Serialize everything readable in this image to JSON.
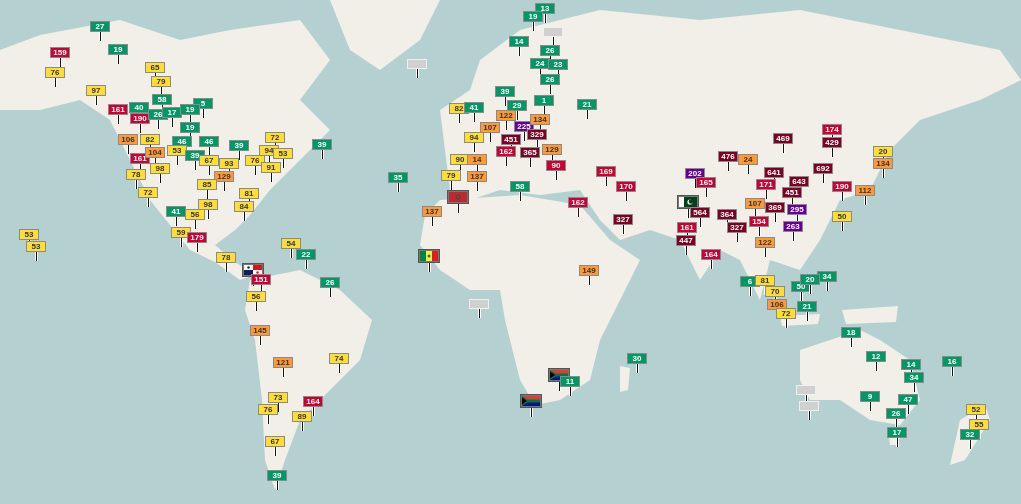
{
  "map": {
    "markers": [
      {
        "kind": "aqi",
        "value": "13",
        "color": "#009966"
      },
      {
        "kind": "aqi",
        "value": "19",
        "color": "#009966"
      },
      {
        "kind": "aqi",
        "value": "27",
        "color": "#009966"
      },
      {
        "kind": "blank"
      },
      {
        "kind": "aqi",
        "value": "14",
        "color": "#009966"
      },
      {
        "kind": "aqi",
        "value": "159",
        "color": "#cc0033"
      },
      {
        "kind": "aqi",
        "value": "19",
        "color": "#009966"
      },
      {
        "kind": "aqi",
        "value": "26",
        "color": "#009966"
      },
      {
        "kind": "aqi",
        "value": "65",
        "color": "#ffde33"
      },
      {
        "kind": "blank"
      },
      {
        "kind": "aqi",
        "value": "24",
        "color": "#009966"
      },
      {
        "kind": "aqi",
        "value": "23",
        "color": "#009966"
      },
      {
        "kind": "aqi",
        "value": "76",
        "color": "#ffde33"
      },
      {
        "kind": "aqi",
        "value": "79",
        "color": "#ffde33"
      },
      {
        "kind": "aqi",
        "value": "26",
        "color": "#009966"
      },
      {
        "kind": "aqi",
        "value": "97",
        "color": "#ffde33"
      },
      {
        "kind": "aqi",
        "value": "39",
        "color": "#009966"
      },
      {
        "kind": "aqi",
        "value": "40",
        "color": "#009966"
      },
      {
        "kind": "aqi",
        "value": "58",
        "color": "#009966"
      },
      {
        "kind": "aqi",
        "value": "5",
        "color": "#009966"
      },
      {
        "kind": "aqi",
        "value": "82",
        "color": "#ffde33"
      },
      {
        "kind": "aqi",
        "value": "41",
        "color": "#009966"
      },
      {
        "kind": "aqi",
        "value": "29",
        "color": "#009966"
      },
      {
        "kind": "aqi",
        "value": "1",
        "color": "#009966"
      },
      {
        "kind": "aqi",
        "value": "21",
        "color": "#009966"
      },
      {
        "kind": "aqi",
        "value": "161",
        "color": "#cc0033"
      },
      {
        "kind": "aqi",
        "value": "190",
        "color": "#cc0033"
      },
      {
        "kind": "aqi",
        "value": "26",
        "color": "#009966"
      },
      {
        "kind": "aqi",
        "value": "17",
        "color": "#009966"
      },
      {
        "kind": "aqi",
        "value": "19",
        "color": "#009966"
      },
      {
        "kind": "aqi",
        "value": "122",
        "color": "#ff9933"
      },
      {
        "kind": "aqi",
        "value": "19",
        "color": "#009966"
      },
      {
        "kind": "aqi",
        "value": "107",
        "color": "#ff9933"
      },
      {
        "kind": "aqi",
        "value": "225",
        "color": "#660099"
      },
      {
        "kind": "aqi",
        "value": "134",
        "color": "#ff9933"
      },
      {
        "kind": "aqi",
        "value": "72",
        "color": "#ffde33"
      },
      {
        "kind": "aqi",
        "value": "94",
        "color": "#ffde33"
      },
      {
        "kind": "aqi",
        "value": "329",
        "color": "#7e0023"
      },
      {
        "kind": "aqi",
        "value": "469",
        "color": "#7e0023"
      },
      {
        "kind": "aqi",
        "value": "174",
        "color": "#cc0033"
      },
      {
        "kind": "aqi",
        "value": "106",
        "color": "#ff9933"
      },
      {
        "kind": "aqi",
        "value": "82",
        "color": "#ffde33"
      },
      {
        "kind": "aqi",
        "value": "46",
        "color": "#009966"
      },
      {
        "kind": "aqi",
        "value": "46",
        "color": "#009966"
      },
      {
        "kind": "aqi",
        "value": "39",
        "color": "#009966"
      },
      {
        "kind": "aqi",
        "value": "39",
        "color": "#009966"
      },
      {
        "kind": "aqi",
        "value": "451",
        "color": "#7e0023"
      },
      {
        "kind": "aqi",
        "value": "429",
        "color": "#7e0023"
      },
      {
        "kind": "aqi",
        "value": "161",
        "color": "#cc0033"
      },
      {
        "kind": "aqi",
        "value": "104",
        "color": "#ff9933"
      },
      {
        "kind": "aqi",
        "value": "53",
        "color": "#ffde33"
      },
      {
        "kind": "aqi",
        "value": "39",
        "color": "#009966"
      },
      {
        "kind": "aqi",
        "value": "94",
        "color": "#ffde33"
      },
      {
        "kind": "aqi",
        "value": "53",
        "color": "#ffde33"
      },
      {
        "kind": "aqi",
        "value": "162",
        "color": "#cc0033"
      },
      {
        "kind": "aqi",
        "value": "365",
        "color": "#7e0023"
      },
      {
        "kind": "aqi",
        "value": "129",
        "color": "#ff9933"
      },
      {
        "kind": "aqi",
        "value": "476",
        "color": "#7e0023"
      },
      {
        "kind": "aqi",
        "value": "20",
        "color": "#ffde33"
      },
      {
        "kind": "aqi",
        "value": "98",
        "color": "#ffde33"
      },
      {
        "kind": "aqi",
        "value": "67",
        "color": "#ffde33"
      },
      {
        "kind": "aqi",
        "value": "93",
        "color": "#ffde33"
      },
      {
        "kind": "aqi",
        "value": "76",
        "color": "#ffde33"
      },
      {
        "kind": "aqi",
        "value": "91",
        "color": "#ffde33"
      },
      {
        "kind": "aqi",
        "value": "90",
        "color": "#ffde33"
      },
      {
        "kind": "aqi",
        "value": "14",
        "color": "#ff9933"
      },
      {
        "kind": "aqi",
        "value": "90",
        "color": "#cc0033"
      },
      {
        "kind": "aqi",
        "value": "24",
        "color": "#ff9933"
      },
      {
        "kind": "aqi",
        "value": "692",
        "color": "#7e0023"
      },
      {
        "kind": "aqi",
        "value": "134",
        "color": "#ff9933"
      },
      {
        "kind": "aqi",
        "value": "78",
        "color": "#ffde33"
      },
      {
        "kind": "aqi",
        "value": "129",
        "color": "#ff9933"
      },
      {
        "kind": "aqi",
        "value": "35",
        "color": "#009966"
      },
      {
        "kind": "aqi",
        "value": "79",
        "color": "#ffde33"
      },
      {
        "kind": "aqi",
        "value": "137",
        "color": "#ff9933"
      },
      {
        "kind": "aqi",
        "value": "169",
        "color": "#cc0033"
      },
      {
        "kind": "aqi",
        "value": "202",
        "color": "#660099"
      },
      {
        "kind": "aqi",
        "value": "641",
        "color": "#7e0023"
      },
      {
        "kind": "aqi",
        "value": "85",
        "color": "#ffde33"
      },
      {
        "kind": "aqi",
        "value": "58",
        "color": "#009966"
      },
      {
        "kind": "aqi",
        "value": "170",
        "color": "#cc0033"
      },
      {
        "kind": "aqi",
        "value": "165",
        "color": "#cc0033"
      },
      {
        "kind": "aqi",
        "value": "171",
        "color": "#cc0033"
      },
      {
        "kind": "aqi",
        "value": "643",
        "color": "#7e0023"
      },
      {
        "kind": "aqi",
        "value": "190",
        "color": "#cc0033"
      },
      {
        "kind": "aqi",
        "value": "72",
        "color": "#ffde33"
      },
      {
        "kind": "aqi",
        "value": "81",
        "color": "#ffde33"
      },
      {
        "kind": "flag"
      },
      {
        "kind": "aqi",
        "value": "451",
        "color": "#7e0023"
      },
      {
        "kind": "aqi",
        "value": "112",
        "color": "#ff9933"
      },
      {
        "kind": "aqi",
        "value": "98",
        "color": "#ffde33"
      },
      {
        "kind": "aqi",
        "value": "84",
        "color": "#ffde33"
      },
      {
        "kind": "aqi",
        "value": "162",
        "color": "#cc0033"
      },
      {
        "kind": "flag"
      },
      {
        "kind": "aqi",
        "value": "107",
        "color": "#ff9933"
      },
      {
        "kind": "aqi",
        "value": "369",
        "color": "#7e0023"
      },
      {
        "kind": "aqi",
        "value": "41",
        "color": "#009966"
      },
      {
        "kind": "aqi",
        "value": "56",
        "color": "#ffde33"
      },
      {
        "kind": "aqi",
        "value": "137",
        "color": "#ff9933"
      },
      {
        "kind": "aqi",
        "value": "564",
        "color": "#7e0023"
      },
      {
        "kind": "aqi",
        "value": "364",
        "color": "#7e0023"
      },
      {
        "kind": "aqi",
        "value": "295",
        "color": "#660099"
      },
      {
        "kind": "aqi",
        "value": "50",
        "color": "#ffde33"
      },
      {
        "kind": "aqi",
        "value": "327",
        "color": "#7e0023"
      },
      {
        "kind": "aqi",
        "value": "161",
        "color": "#cc0033"
      },
      {
        "kind": "aqi",
        "value": "327",
        "color": "#7e0023"
      },
      {
        "kind": "aqi",
        "value": "154",
        "color": "#cc0033"
      },
      {
        "kind": "aqi",
        "value": "263",
        "color": "#660099"
      },
      {
        "kind": "aqi",
        "value": "53",
        "color": "#ffde33"
      },
      {
        "kind": "aqi",
        "value": "59",
        "color": "#ffde33"
      },
      {
        "kind": "aqi",
        "value": "179",
        "color": "#cc0033"
      },
      {
        "kind": "aqi",
        "value": "53",
        "color": "#ffde33"
      },
      {
        "kind": "aqi",
        "value": "54",
        "color": "#ffde33"
      },
      {
        "kind": "aqi",
        "value": "447",
        "color": "#7e0023"
      },
      {
        "kind": "aqi",
        "value": "122",
        "color": "#ff9933"
      },
      {
        "kind": "aqi",
        "value": "78",
        "color": "#ffde33"
      },
      {
        "kind": "aqi",
        "value": "22",
        "color": "#009966"
      },
      {
        "kind": "flag"
      },
      {
        "kind": "aqi",
        "value": "164",
        "color": "#cc0033"
      },
      {
        "kind": "flag"
      },
      {
        "kind": "aqi",
        "value": "149",
        "color": "#ff9933"
      },
      {
        "kind": "aqi",
        "value": "34",
        "color": "#009966"
      },
      {
        "kind": "aqi",
        "value": "151",
        "color": "#cc0033"
      },
      {
        "kind": "aqi",
        "value": "26",
        "color": "#009966"
      },
      {
        "kind": "aqi",
        "value": "6",
        "color": "#009966"
      },
      {
        "kind": "aqi",
        "value": "81",
        "color": "#ffde33"
      },
      {
        "kind": "aqi",
        "value": "50",
        "color": "#009966"
      },
      {
        "kind": "aqi",
        "value": "20",
        "color": "#009966"
      },
      {
        "kind": "aqi",
        "value": "56",
        "color": "#ffde33"
      },
      {
        "kind": "aqi",
        "value": "70",
        "color": "#ffde33"
      },
      {
        "kind": "blank"
      },
      {
        "kind": "aqi",
        "value": "106",
        "color": "#ff9933"
      },
      {
        "kind": "aqi",
        "value": "21",
        "color": "#009966"
      },
      {
        "kind": "aqi",
        "value": "72",
        "color": "#ffde33"
      },
      {
        "kind": "aqi",
        "value": "145",
        "color": "#ff9933"
      },
      {
        "kind": "aqi",
        "value": "18",
        "color": "#009966"
      },
      {
        "kind": "aqi",
        "value": "74",
        "color": "#ffde33"
      },
      {
        "kind": "aqi",
        "value": "30",
        "color": "#009966"
      },
      {
        "kind": "aqi",
        "value": "12",
        "color": "#009966"
      },
      {
        "kind": "aqi",
        "value": "121",
        "color": "#ff9933"
      },
      {
        "kind": "aqi",
        "value": "14",
        "color": "#009966"
      },
      {
        "kind": "aqi",
        "value": "16",
        "color": "#009966"
      },
      {
        "kind": "flag"
      },
      {
        "kind": "aqi",
        "value": "34",
        "color": "#009966"
      },
      {
        "kind": "aqi",
        "value": "11",
        "color": "#009966"
      },
      {
        "kind": "aqi",
        "value": "73",
        "color": "#ffde33"
      },
      {
        "kind": "blank"
      },
      {
        "kind": "aqi",
        "value": "9",
        "color": "#009966"
      },
      {
        "kind": "aqi",
        "value": "164",
        "color": "#cc0033"
      },
      {
        "kind": "flag"
      },
      {
        "kind": "blank"
      },
      {
        "kind": "aqi",
        "value": "47",
        "color": "#009966"
      },
      {
        "kind": "aqi",
        "value": "76",
        "color": "#ffde33"
      },
      {
        "kind": "aqi",
        "value": "89",
        "color": "#ffde33"
      },
      {
        "kind": "aqi",
        "value": "26",
        "color": "#009966"
      },
      {
        "kind": "aqi",
        "value": "52",
        "color": "#ffde33"
      },
      {
        "kind": "aqi",
        "value": "55",
        "color": "#ffde33"
      },
      {
        "kind": "aqi",
        "value": "17",
        "color": "#009966"
      },
      {
        "kind": "aqi",
        "value": "32",
        "color": "#009966"
      },
      {
        "kind": "aqi",
        "value": "67",
        "color": "#ffde33"
      },
      {
        "kind": "aqi",
        "value": "39",
        "color": "#009966"
      }
    ]
  }
}
